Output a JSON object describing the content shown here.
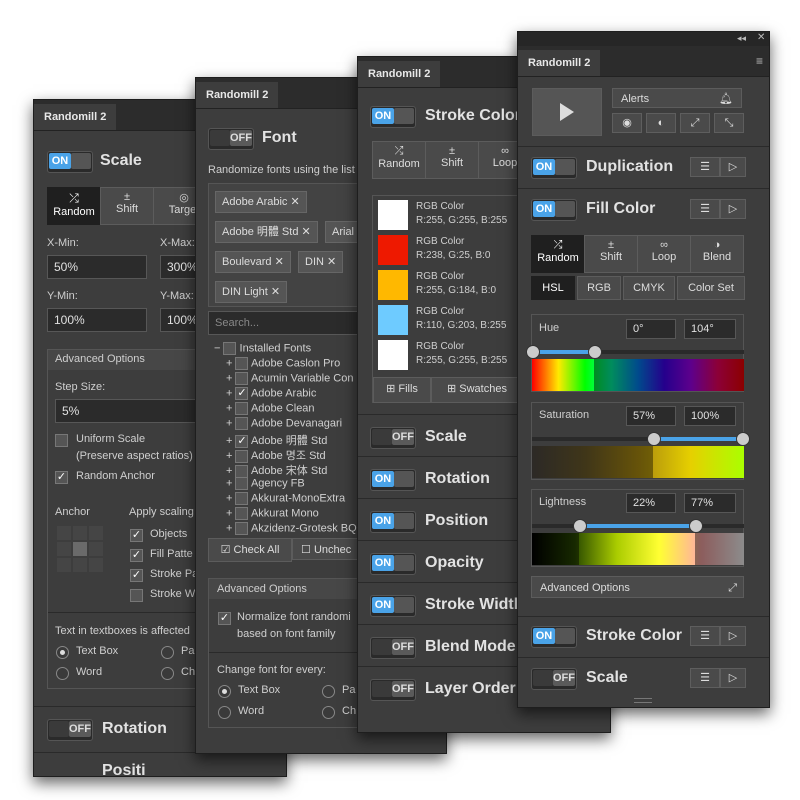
{
  "panel1": {
    "tab": "Randomill 2",
    "scale_toggle": "ON",
    "title": "Scale",
    "modes": [
      "Random",
      "Shift",
      "Target"
    ],
    "xmin_label": "X-Min:",
    "xmin": "50%",
    "xmax_label": "X-Max:",
    "xmax": "300%",
    "ymin_label": "Y-Min:",
    "ymin": "100%",
    "ymax_label": "Y-Max:",
    "ymax": "100%",
    "advanced": "Advanced Options",
    "step_label": "Step Size:",
    "step": "5%",
    "uniform": "Uniform Scale",
    "uniform_sub": "(Preserve aspect ratios)",
    "random_anchor": "Random Anchor",
    "anchor_label": "Anchor",
    "apply_label": "Apply scaling",
    "apply_items": [
      "Objects",
      "Fill Patte",
      "Stroke Pa",
      "Stroke W"
    ],
    "text_label": "Text in textboxes is affected",
    "radio_items": [
      "Text Box",
      "Pa",
      "Word",
      "Ch"
    ],
    "rotation_toggle": "OFF",
    "rotation": "Rotation",
    "position": "Positi"
  },
  "panel2": {
    "tab": "Randomill 2",
    "toggle": "OFF",
    "title": "Font",
    "desc": "Randomize fonts using the list",
    "chips": [
      "Adobe Arabic",
      "Adobe 明體 Std",
      "Arial",
      "Boulevard",
      "DIN",
      "DIN Light"
    ],
    "search_placeholder": "Search...",
    "root": "Installed Fonts",
    "fonts": [
      "Adobe Caslon Pro",
      "Acumin Variable Con",
      "Adobe Arabic",
      "Adobe Clean",
      "Adobe Devanagari",
      "Adobe 明體 Std",
      "Adobe 명조 Std",
      "Adobe 宋体 Std",
      "Agency FB",
      "Akkurat-MonoExtra",
      "Akkurat Mono",
      "Akzidenz-Grotesk BQ"
    ],
    "checked_fonts": [
      2,
      5
    ],
    "check_all": "Check All",
    "uncheck": "Unchec",
    "advanced": "Advanced Options",
    "normalize": "Normalize font randomi",
    "normalize2": "based on font family",
    "change_label": "Change font for every:",
    "radio_items": [
      "Text Box",
      "Pa",
      "Word",
      "Ch"
    ]
  },
  "panel3": {
    "tab": "Randomill 2",
    "stroke_toggle": "ON",
    "stroke_title": "Stroke Color",
    "modes": [
      "Random",
      "Shift",
      "Loop"
    ],
    "swatch_colors": [
      "#ffffff",
      "#ee1900",
      "#ffb800",
      "#6ecbff",
      "#ffffff"
    ],
    "swatch_title": "RGB Color",
    "swatch_values": [
      "R:255, G:255, B:255",
      "R:238, G:25, B:0",
      "R:255, G:184, B:0",
      "R:110, G:203, B:255",
      "R:255, G:255, B:255"
    ],
    "fills": "Fills",
    "swatches": "Swatches",
    "rows": [
      {
        "toggle": "OFF",
        "title": "Scale"
      },
      {
        "toggle": "ON",
        "title": "Rotation"
      },
      {
        "toggle": "ON",
        "title": "Position"
      },
      {
        "toggle": "ON",
        "title": "Opacity"
      },
      {
        "toggle": "ON",
        "title": "Stroke Width"
      },
      {
        "toggle": "OFF",
        "title": "Blend Mode"
      },
      {
        "toggle": "OFF",
        "title": "Layer Order"
      }
    ]
  },
  "panel4": {
    "tab": "Randomill 2",
    "alerts": "Alerts",
    "dup_toggle": "ON",
    "dup_title": "Duplication",
    "fill_toggle": "ON",
    "fill_title": "Fill Color",
    "modes": [
      "Random",
      "Shift",
      "Loop",
      "Blend"
    ],
    "spaces": [
      "HSL",
      "RGB",
      "CMYK",
      "Color Set"
    ],
    "hue_label": "Hue",
    "hue_min": "0°",
    "hue_max": "104°",
    "sat_label": "Saturation",
    "sat_min": "57%",
    "sat_max": "100%",
    "light_label": "Lightness",
    "light_min": "22%",
    "light_max": "77%",
    "advanced": "Advanced Options",
    "stroke_toggle": "ON",
    "stroke_title": "Stroke Color",
    "scale_toggle": "OFF",
    "scale_title": "Scale"
  }
}
